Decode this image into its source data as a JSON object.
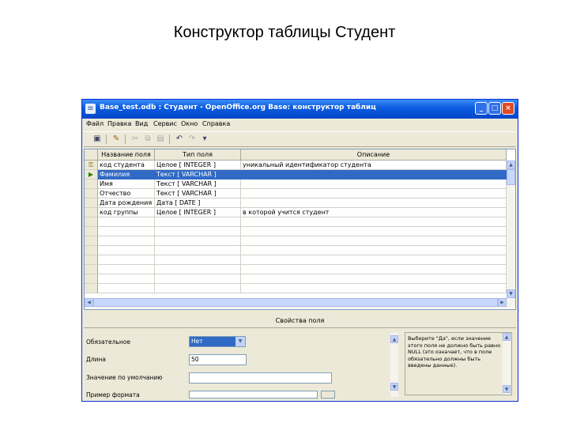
{
  "slide_title": "Конструктор таблицы Студент",
  "window": {
    "title": "Base_test.odb : Студент - OpenOffice.org Base: конструктор таблиц",
    "minimize_glyph": "_",
    "maximize_glyph": "□",
    "close_glyph": "×"
  },
  "menu": [
    "Файл",
    "Правка",
    "Вид",
    "Сервис",
    "Окно",
    "Справка"
  ],
  "toolbar_glyphs": {
    "save": "▣",
    "edit": "✎",
    "cut": "✂",
    "copy": "⧉",
    "paste": "▤",
    "undo": "↶",
    "redo": "↷",
    "more": "▾"
  },
  "grid": {
    "columns": [
      "Название поля",
      "Тип поля",
      "Описание"
    ],
    "rows": [
      {
        "marker": "⚿",
        "name": "код студента",
        "type": "Целое [ INTEGER ]",
        "description": "уникальный идентификатор студента"
      },
      {
        "marker": "▶",
        "name": "Фамилия",
        "type": "Текст [ VARCHAR ]",
        "description": ""
      },
      {
        "marker": "",
        "name": "Имя",
        "type": "Текст [ VARCHAR ]",
        "description": ""
      },
      {
        "marker": "",
        "name": "Отчество",
        "type": "Текст [ VARCHAR ]",
        "description": ""
      },
      {
        "marker": "",
        "name": "Дата рождения",
        "type": "Дата [ DATE ]",
        "description": ""
      },
      {
        "marker": "",
        "name": "код группы",
        "type": "Целое [ INTEGER ]",
        "description": "в которой учится студент"
      }
    ],
    "selected_row": 1,
    "empty_rows": 8
  },
  "properties": {
    "title": "Свойства поля",
    "required_label": "Обязательное",
    "required_value": "Нет",
    "length_label": "Длина",
    "length_value": "50",
    "default_label": "Значение по умолчанию",
    "default_value": "",
    "format_label": "Пример формата",
    "help_text": "Выберите \"Да\", если значение этого поля не должно быть равно NULL (это означает, что в поле обязательно должны быть введены данные)."
  },
  "scroll_glyphs": {
    "up": "▲",
    "down": "▼",
    "left": "◀",
    "right": "▶"
  }
}
